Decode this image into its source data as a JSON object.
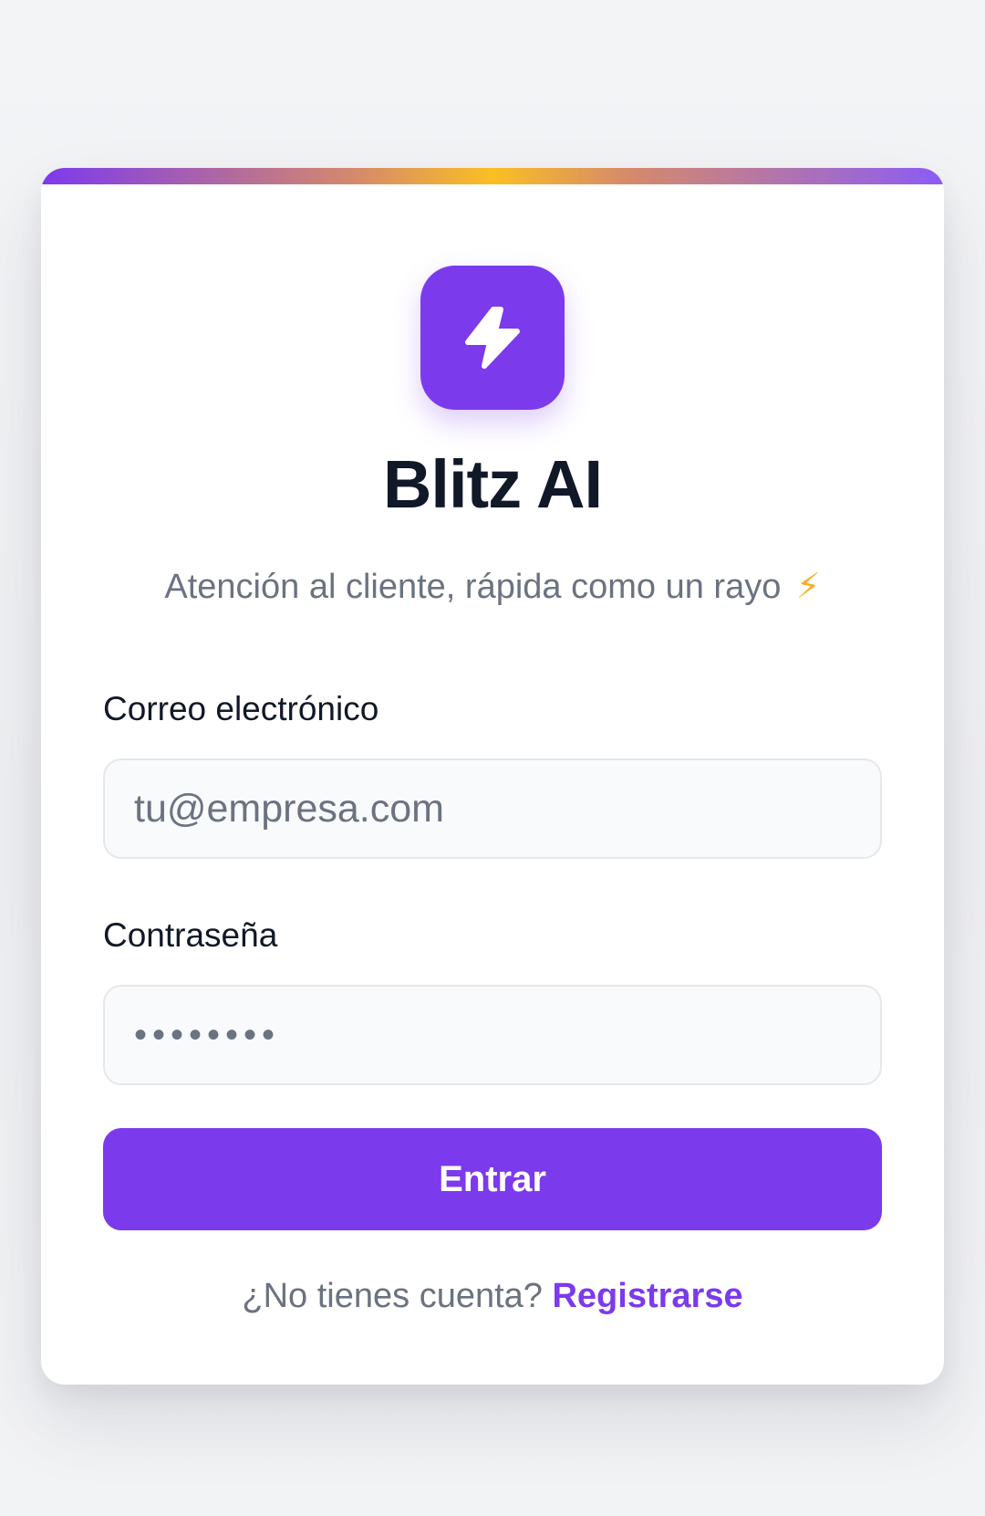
{
  "brand": {
    "name": "Blitz AI",
    "tagline": "Atención al cliente, rápida como un rayo",
    "tagline_emoji": "⚡",
    "logo_icon": "lightning-bolt-icon",
    "accent_color": "#7c3aed",
    "highlight_color": "#fbbf24"
  },
  "form": {
    "email_label": "Correo electrónico",
    "email_placeholder": "tu@empresa.com",
    "email_value": "",
    "password_label": "Contraseña",
    "password_value": "••••••••",
    "submit_label": "Entrar"
  },
  "footer": {
    "prompt": "¿No tienes cuenta?",
    "register_link": "Registrarse"
  }
}
